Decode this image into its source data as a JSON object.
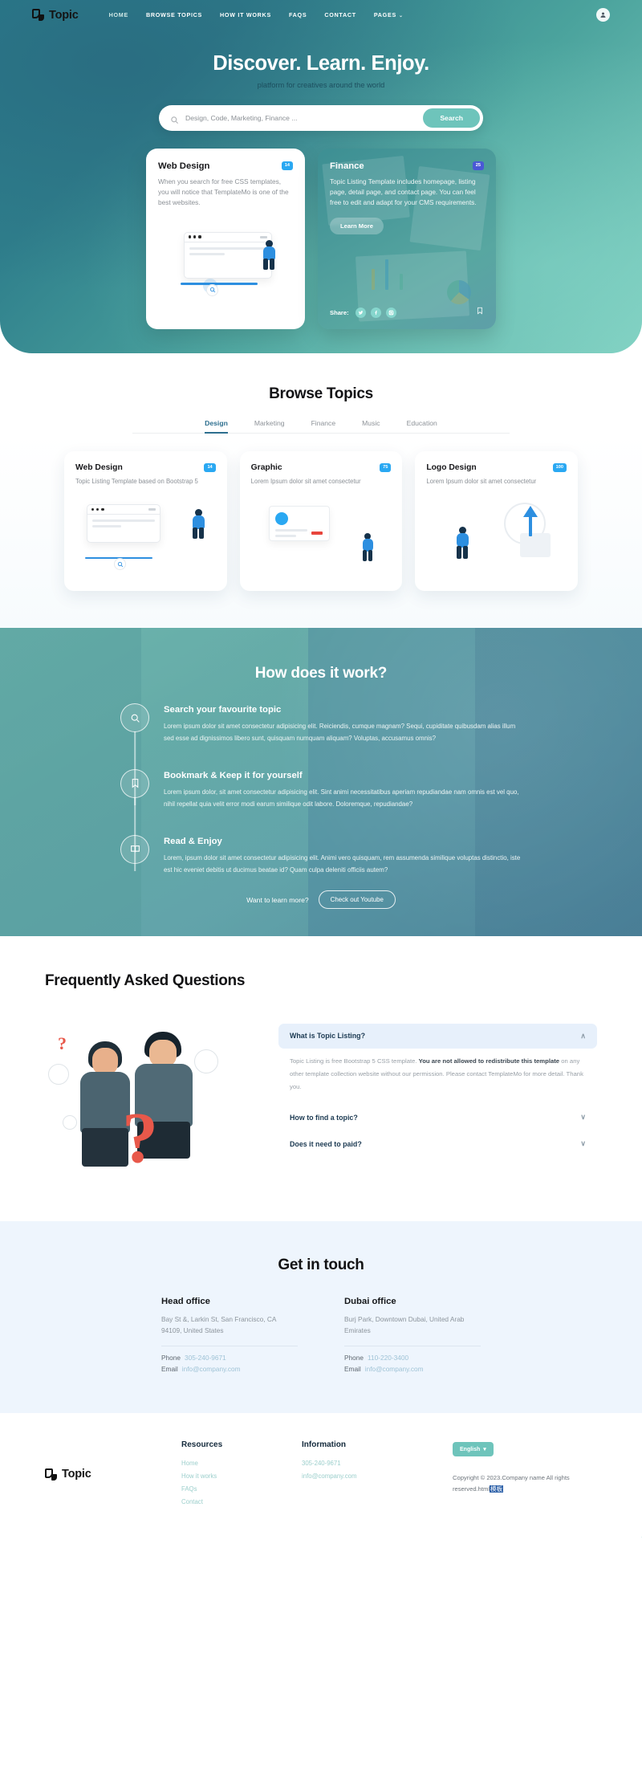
{
  "nav": {
    "brand": "Topic",
    "links": [
      {
        "label": "HOME",
        "active": true
      },
      {
        "label": "BROWSE TOPICS",
        "active": false
      },
      {
        "label": "HOW IT WORKS",
        "active": false
      },
      {
        "label": "FAQS",
        "active": false
      },
      {
        "label": "CONTACT",
        "active": false
      },
      {
        "label": "PAGES",
        "active": false,
        "caret": "⌄"
      }
    ],
    "account_icon": "user-icon"
  },
  "hero": {
    "title": "Discover. Learn. Enjoy.",
    "subtitle": "platform for creatives around the world",
    "search": {
      "placeholder": "Design, Code, Marketing, Finance ...",
      "value": "",
      "button": "Search",
      "icon": "search-icon"
    },
    "cards": [
      {
        "title": "Web Design",
        "badge": "14",
        "text": "When you search for free CSS templates, you will notice that TemplateMo is one of the best websites."
      },
      {
        "title": "Finance",
        "badge": "25",
        "text": "Topic Listing Template includes homepage, listing page, detail page, and contact page. You can feel free to edit and adapt for your CMS requirements.",
        "cta": "Learn More",
        "share_label": "Share:",
        "share_icons": [
          "twitter-icon",
          "facebook-icon",
          "instagram-icon"
        ],
        "bookmark_icon": "bookmark-icon"
      }
    ]
  },
  "browse": {
    "title": "Browse Topics",
    "tabs": [
      {
        "label": "Design",
        "active": true
      },
      {
        "label": "Marketing",
        "active": false
      },
      {
        "label": "Finance",
        "active": false
      },
      {
        "label": "Music",
        "active": false
      },
      {
        "label": "Education",
        "active": false
      }
    ],
    "cards": [
      {
        "title": "Web Design",
        "badge": "14",
        "text": "Topic Listing Template based on Bootstrap 5"
      },
      {
        "title": "Graphic",
        "badge": "75",
        "text": "Lorem Ipsum dolor sit amet consectetur"
      },
      {
        "title": "Logo Design",
        "badge": "100",
        "text": "Lorem Ipsum dolor sit amet consectetur"
      }
    ]
  },
  "how": {
    "title": "How does it work?",
    "steps": [
      {
        "icon": "search-icon",
        "title": "Search your favourite topic",
        "text": "Lorem ipsum dolor sit amet consectetur adipisicing elit. Reiciendis, cumque magnam? Sequi, cupiditate quibusdam alias illum sed esse ad dignissimos libero sunt, quisquam numquam aliquam? Voluptas, accusamus omnis?"
      },
      {
        "icon": "bookmark-icon",
        "title": "Bookmark & Keep it for yourself",
        "text": "Lorem ipsum dolor, sit amet consectetur adipisicing elit. Sint animi necessitatibus aperiam repudiandae nam omnis est vel quo, nihil repellat quia velit error modi earum similique odit labore. Doloremque, repudiandae?"
      },
      {
        "icon": "book-icon",
        "title": "Read & Enjoy",
        "text": "Lorem, ipsum dolor sit amet consectetur adipisicing elit. Animi vero quisquam, rem assumenda similique voluptas distinctio, iste est hic eveniet debitis ut ducimus beatae id? Quam culpa deleniti officiis autem?"
      }
    ],
    "learn_more_label": "Want to learn more?",
    "youtube_button": "Check out Youtube"
  },
  "faq": {
    "title": "Frequently Asked Questions",
    "items": [
      {
        "question": "What is Topic Listing?",
        "open": true,
        "chevron": "∧",
        "answer_parts": [
          {
            "text": "Topic Listing is free Bootstrap 5 CSS template. ",
            "bold": false
          },
          {
            "text": "You are not allowed to redistribute this template",
            "bold": true
          },
          {
            "text": " on any other template collection website without our permission. Please contact TemplateMo for more detail. Thank you.",
            "bold": false
          }
        ]
      },
      {
        "question": "How to find a topic?",
        "open": false,
        "chevron": "∨"
      },
      {
        "question": "Does it need to paid?",
        "open": false,
        "chevron": "∨"
      }
    ]
  },
  "contact": {
    "title": "Get in touch",
    "offices": [
      {
        "name": "Head office",
        "address": "Bay St &, Larkin St, San Francisco, CA 94109, United States",
        "phone_label": "Phone",
        "phone": "305-240-9671",
        "email_label": "Email",
        "email": "info@company.com"
      },
      {
        "name": "Dubai office",
        "address": "Burj Park, Downtown Dubai, United Arab Emirates",
        "phone_label": "Phone",
        "phone": "110-220-3400",
        "email_label": "Email",
        "email": "info@company.com"
      }
    ]
  },
  "footer": {
    "brand": "Topic",
    "columns": [
      {
        "heading": "Resources",
        "links": [
          "Home",
          "How it works",
          "FAQs",
          "Contact"
        ]
      },
      {
        "heading": "Information",
        "links": [
          "305-240-9671",
          "info@company.com"
        ]
      }
    ],
    "language": "English",
    "language_caret": "▾",
    "copyright": "Copyright © 2023.Company name All rights reserved.html",
    "copyright_mark": "模板"
  },
  "colors": {
    "teal": "#6ec4bb",
    "blue_badge": "#2aa8f2",
    "purple_badge": "#4a58d6",
    "faq_open_bg": "#e7f0fb",
    "contact_bg": "#eef5fd"
  }
}
